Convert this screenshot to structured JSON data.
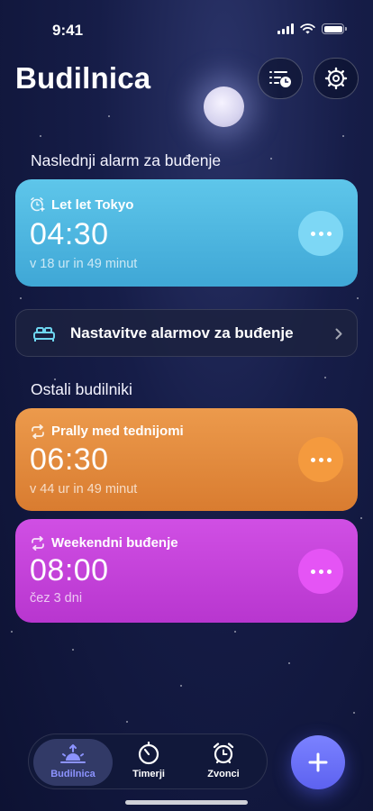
{
  "status_bar": {
    "time": "9:41"
  },
  "header": {
    "title": "Budilnica"
  },
  "next_alarm": {
    "section_label": "Naslednji alarm za buđenje",
    "name": "Let let Tokyo",
    "time": "04:30",
    "countdown": "v 18 ur in 49 minut",
    "color": "#4fb8e2"
  },
  "settings_row": {
    "label": "Nastavitve alarmov za buđenje"
  },
  "other_alarms": {
    "section_label": "Ostali budilniki",
    "items": [
      {
        "name": "Prally med tednijomi",
        "time": "06:30",
        "countdown": "v 44 ur in 49 minut",
        "color": "#e08838"
      },
      {
        "name": "Weekendni buđenje",
        "time": "08:00",
        "countdown": "čez 3 dni",
        "color": "#c43fd8"
      }
    ]
  },
  "tabs": [
    {
      "label": "Budilnica",
      "icon": "sunrise-icon",
      "active": true
    },
    {
      "label": "Timerji",
      "icon": "timer-icon",
      "active": false
    },
    {
      "label": "Zvonci",
      "icon": "alarm-clock-icon",
      "active": false
    }
  ],
  "fab": {
    "icon": "plus-icon"
  }
}
